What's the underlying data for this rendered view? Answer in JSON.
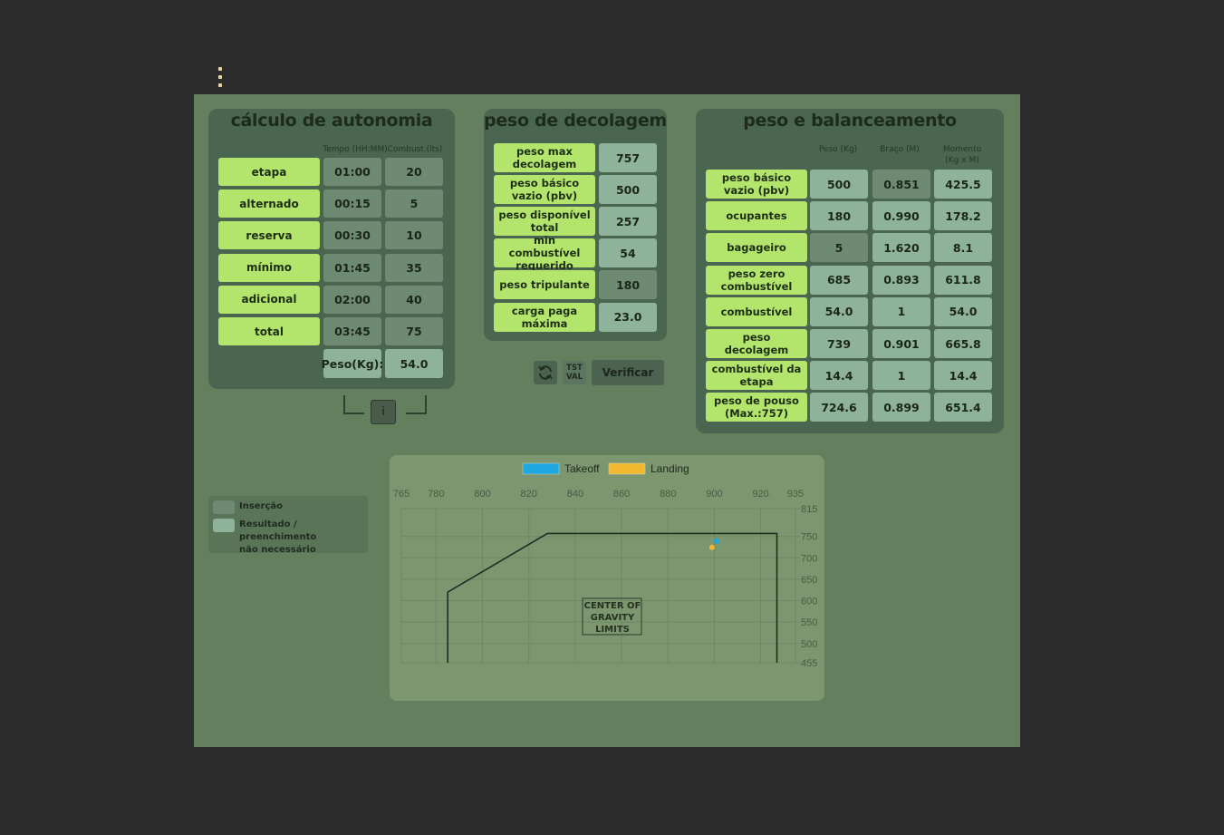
{
  "autonomia": {
    "title": "cálculo de autonomia",
    "col_tempo": "Tempo (HH:MM)",
    "col_combust": "Combust.(lts)",
    "rows": [
      {
        "label": "etapa",
        "tempo": "01:00",
        "combust": "20"
      },
      {
        "label": "alternado",
        "tempo": "00:15",
        "combust": "5"
      },
      {
        "label": "reserva",
        "tempo": "00:30",
        "combust": "10"
      },
      {
        "label": "mínimo",
        "tempo": "01:45",
        "combust": "35"
      },
      {
        "label": "adicional",
        "tempo": "02:00",
        "combust": "40"
      },
      {
        "label": "total",
        "tempo": "03:45",
        "combust": "75"
      }
    ],
    "peso_label": "Peso(Kg):",
    "peso_value": "54.0",
    "info_label": "i"
  },
  "decolagem": {
    "title": "peso de decolagem",
    "rows": [
      {
        "label": "peso max decolagem",
        "value": "757"
      },
      {
        "label": "peso básico vazio (pbv)",
        "value": "500"
      },
      {
        "label": "peso disponível total",
        "value": "257"
      },
      {
        "label": "min combustível requerido",
        "value": "54"
      },
      {
        "label": "peso tripulante",
        "value": "180"
      },
      {
        "label": "carga paga máxima",
        "value": "23.0"
      }
    ],
    "tst_label": "TST",
    "val_label": "VAL",
    "verify_label": "Verificar"
  },
  "balanceamento": {
    "title": "peso e balanceamento",
    "col_peso": "Peso (Kg)",
    "col_braco": "Braço (M)",
    "col_momento_1": "Momento",
    "col_momento_2": "(Kg x M)",
    "rows": [
      {
        "label": "peso básico vazio (pbv)",
        "peso": "500",
        "braco": "0.851",
        "momento": "425.5"
      },
      {
        "label": "ocupantes",
        "peso": "180",
        "braco": "0.990",
        "momento": "178.2"
      },
      {
        "label": "bagageiro",
        "peso": "5",
        "braco": "1.620",
        "momento": "8.1"
      },
      {
        "label": "peso zero combustível",
        "peso": "685",
        "braco": "0.893",
        "momento": "611.8"
      },
      {
        "label": "combustível",
        "peso": "54.0",
        "braco": "1",
        "momento": "54.0"
      },
      {
        "label": "peso decolagem",
        "peso": "739",
        "braco": "0.901",
        "momento": "665.8"
      },
      {
        "label": "combustível da etapa",
        "peso": "14.4",
        "braco": "1",
        "momento": "14.4"
      },
      {
        "label": "peso de pouso (Max.:757)",
        "peso": "724.6",
        "braco": "0.899",
        "momento": "651.4"
      }
    ]
  },
  "legend_box": {
    "insercao": "Inserção",
    "resultado_1": "Resultado / preenchimento",
    "resultado_2": "não necessário"
  },
  "chart_data": {
    "type": "scatter",
    "title": "",
    "xlabel": "",
    "ylabel": "",
    "x_ticks": [
      765,
      780,
      800,
      820,
      840,
      860,
      880,
      900,
      920,
      935
    ],
    "y_ticks": [
      455,
      500,
      550,
      600,
      650,
      700,
      750,
      815
    ],
    "xlim": [
      765,
      935
    ],
    "ylim": [
      455,
      815
    ],
    "legend": "top",
    "series": [
      {
        "name": "Takeoff",
        "color": "#1ea7e1",
        "points": [
          {
            "x": 901,
            "y": 739
          }
        ]
      },
      {
        "name": "Landing",
        "color": "#f2b830",
        "points": [
          {
            "x": 899,
            "y": 724.6
          }
        ]
      }
    ],
    "envelope": [
      [
        785,
        455
      ],
      [
        785,
        620
      ],
      [
        828,
        757
      ],
      [
        927,
        757
      ],
      [
        927,
        455
      ]
    ],
    "annotation": [
      "CENTER OF",
      "GRAVITY",
      "LIMITS"
    ]
  },
  "colors": {
    "label_green": "#b3e56d",
    "insertion": "#6f8a72",
    "result": "#8fb39a"
  }
}
